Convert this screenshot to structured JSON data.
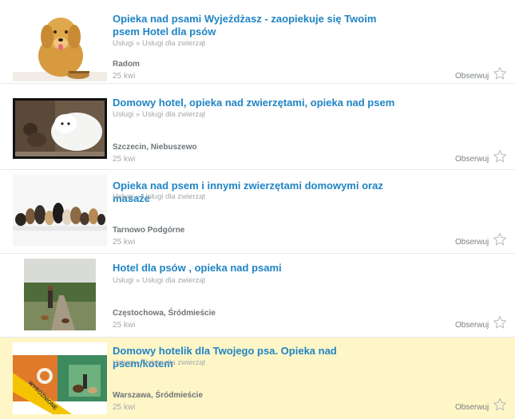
{
  "offers": [
    {
      "title": "Opieka nad psami Wyjeżdżasz - zaopiekuje się Twoim psem Hotel dla psów",
      "category": "Usługi » Usługi dla zwierząt",
      "location": "Radom",
      "date": "25 kwi",
      "watch_label": "Obserwuj",
      "featured": false
    },
    {
      "title": "Domowy hotel, opieka nad zwierzętami, opieka nad psem",
      "category": "Usługi » Usługi dla zwierząt",
      "location": "Szczecin, Niebuszewo",
      "date": "25 kwi",
      "watch_label": "Obserwuj",
      "featured": false
    },
    {
      "title": "Opieka nad psem i innymi zwierzętami domowymi oraz masaże",
      "category": "Usługi » Usługi dla zwierząt",
      "location": "Tarnowo Podgórne",
      "date": "25 kwi",
      "watch_label": "Obserwuj",
      "featured": false
    },
    {
      "title": "Hotel dla psów , opieka nad psami",
      "category": "Usługi » Usługi dla zwierząt",
      "location": "Częstochowa, Śródmieście",
      "date": "25 kwi",
      "watch_label": "Obserwuj",
      "featured": false
    },
    {
      "title": "Domowy hotelik dla Twojego psa. Opieka nad psem/kotem",
      "category": "Usługi » Usługi dla zwierząt",
      "location": "Warszawa, Śródmieście",
      "date": "25 kwi",
      "watch_label": "Obserwuj",
      "featured": true,
      "badge": "WYRÓŻNIONE"
    }
  ],
  "icons": {
    "watch": "star-outline-icon"
  },
  "colors": {
    "title": "#1f84c4",
    "featured_bg": "#fff6c7",
    "badge": "#f5c400"
  }
}
